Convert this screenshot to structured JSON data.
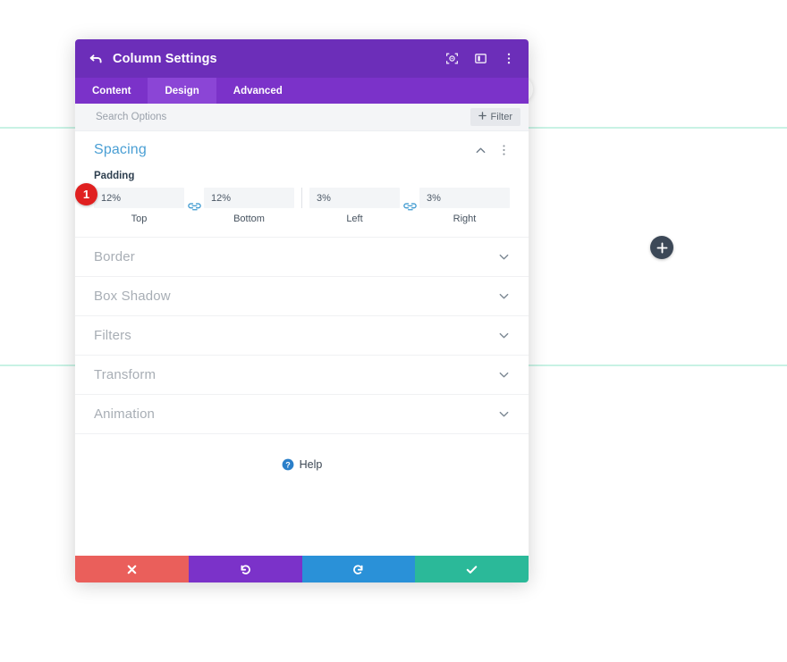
{
  "canvas": {
    "add_button_icon": "plus-icon",
    "globe_badge_icon": "globe-icon",
    "guide_line_color": "#c8f2e4"
  },
  "modal": {
    "header": {
      "back_icon": "back-arrow-icon",
      "title": "Column Settings",
      "icons": [
        {
          "name": "target-icon",
          "label": ""
        },
        {
          "name": "layout-panel-icon",
          "label": ""
        },
        {
          "name": "vertical-dots-icon",
          "label": ""
        }
      ]
    },
    "tabs": [
      {
        "label": "Content",
        "active": false
      },
      {
        "label": "Design",
        "active": true
      },
      {
        "label": "Advanced",
        "active": false
      }
    ],
    "search": {
      "value": "",
      "placeholder": "Search Options",
      "filter_label": "Filter",
      "filter_icon": "plus-icon"
    },
    "spacing": {
      "title": "Spacing",
      "collapse_icon": "chevron-up-icon",
      "menu_icon": "vertical-dots-icon",
      "marker": "1",
      "padding_label": "Padding",
      "fields": [
        {
          "value": "12%",
          "caption": "Top"
        },
        {
          "value": "12%",
          "caption": "Bottom"
        },
        {
          "value": "3%",
          "caption": "Left"
        },
        {
          "value": "3%",
          "caption": "Right"
        }
      ],
      "link_icon": "link-sync-icon"
    },
    "sections": [
      {
        "title": "Border",
        "icon": "chevron-down-icon"
      },
      {
        "title": "Box Shadow",
        "icon": "chevron-down-icon"
      },
      {
        "title": "Filters",
        "icon": "chevron-down-icon"
      },
      {
        "title": "Transform",
        "icon": "chevron-down-icon"
      },
      {
        "title": "Animation",
        "icon": "chevron-down-icon"
      }
    ],
    "help": {
      "icon": "question-circle-icon",
      "label": "Help"
    },
    "footer": [
      {
        "name": "cancel",
        "icon": "close-x-icon",
        "color": "#ea5f5b"
      },
      {
        "name": "undo",
        "icon": "undo-arrow-icon",
        "color": "#7b32c9"
      },
      {
        "name": "redo",
        "icon": "redo-arrow-icon",
        "color": "#2a91d8"
      },
      {
        "name": "save",
        "icon": "checkmark-icon",
        "color": "#2bb999"
      }
    ]
  }
}
